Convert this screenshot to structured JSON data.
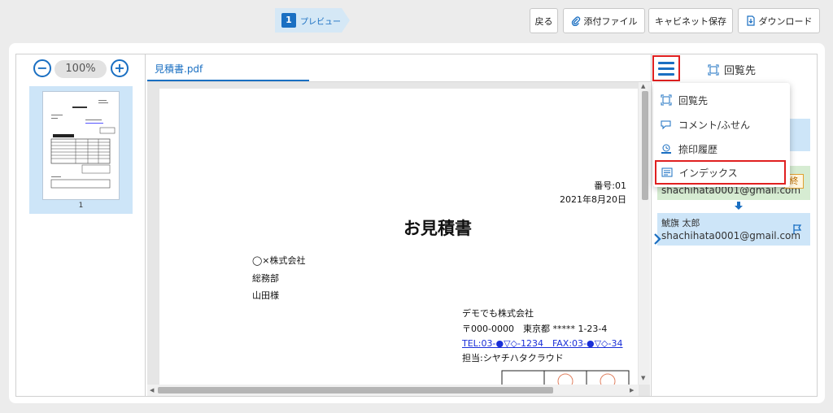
{
  "header": {
    "step_number": "1",
    "step_label": "プレビュー",
    "back_label": "戻る",
    "attach_label": "添付ファイル",
    "cabinet_label": "キャビネット保存",
    "download_label": "ダウンロード"
  },
  "thumbnails": {
    "zoom_minus": "−",
    "zoom_value": "100%",
    "zoom_plus": "+",
    "pages": [
      {
        "number": "1"
      }
    ]
  },
  "document": {
    "tab_label": "見積書.pdf",
    "number_line": "番号:01",
    "date_line": "2021年8月20日",
    "title": "お見積書",
    "recipient_company": "◯×株式会社",
    "recipient_dept": "総務部",
    "recipient_person": "山田様",
    "sender_company": "デモでも株式会社",
    "sender_address": "〒000-0000　東京都 ***** 1-23-4",
    "sender_tel": "TEL:03-●▽◇-1234　FAX:03-●▽◇-34",
    "sender_contact": "担当:シヤチハタクラウド"
  },
  "right_panel": {
    "title": "回覧先",
    "menu": [
      {
        "label": "回覧先",
        "icon": "circulation-icon"
      },
      {
        "label": "コメント/ふせん",
        "icon": "comment-icon"
      },
      {
        "label": "捺印履歴",
        "icon": "stamp-history-icon"
      },
      {
        "label": "インデックス",
        "icon": "index-icon",
        "highlighted": true
      }
    ],
    "approvers": [
      {
        "name": "",
        "email": ""
      },
      {
        "name": "",
        "email": "shachihata0001@gmail.com",
        "badge": "終"
      },
      {
        "name": "鯱旗 太郎",
        "email": "shachihata0001@gmail.com"
      }
    ]
  },
  "colors": {
    "accent": "#1a6fc2",
    "highlight_border": "#e02020",
    "selected_bg": "#cde5f8",
    "done_bg": "#d6ecd2"
  }
}
